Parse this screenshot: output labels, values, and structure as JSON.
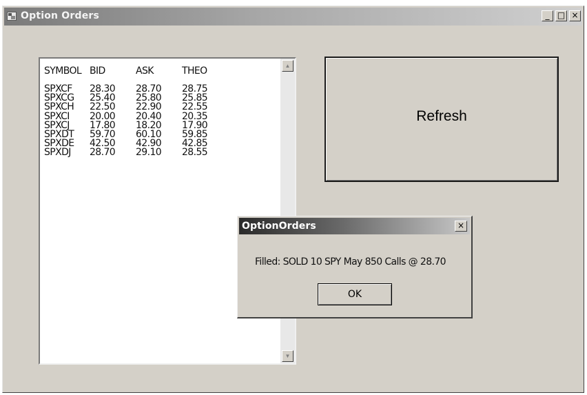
{
  "window": {
    "title": "Option Orders",
    "minimize_glyph": "_",
    "maximize_glyph": "□",
    "close_glyph": "×"
  },
  "list": {
    "headers": [
      "SYMBOL",
      "BID",
      "ASK",
      "THEO"
    ],
    "rows": [
      [
        "SPXCF",
        "28.30",
        "28.70",
        "28.75"
      ],
      [
        "SPXCG",
        "25.40",
        "25.80",
        "25.85"
      ],
      [
        "SPXCH",
        "22.50",
        "22.90",
        "22.55"
      ],
      [
        "SPXCI",
        "20.00",
        "20.40",
        "20.35"
      ],
      [
        "SPXCJ",
        "17.80",
        "18.20",
        "17.90"
      ],
      [
        "SPXDT",
        "59.70",
        "60.10",
        "59.85"
      ],
      [
        "SPXDE",
        "42.50",
        "42.90",
        "42.85"
      ],
      [
        "SPXDJ",
        "28.70",
        "29.10",
        "28.55"
      ]
    ],
    "scroll_up_glyph": "▲",
    "scroll_down_glyph": "▼"
  },
  "refresh_button": {
    "label": "Refresh"
  },
  "dialog": {
    "title": "OptionOrders",
    "close_glyph": "×",
    "message": "Filled: SOLD  10 SPY May 850 Calls @ 28.70",
    "ok_label": "OK"
  }
}
